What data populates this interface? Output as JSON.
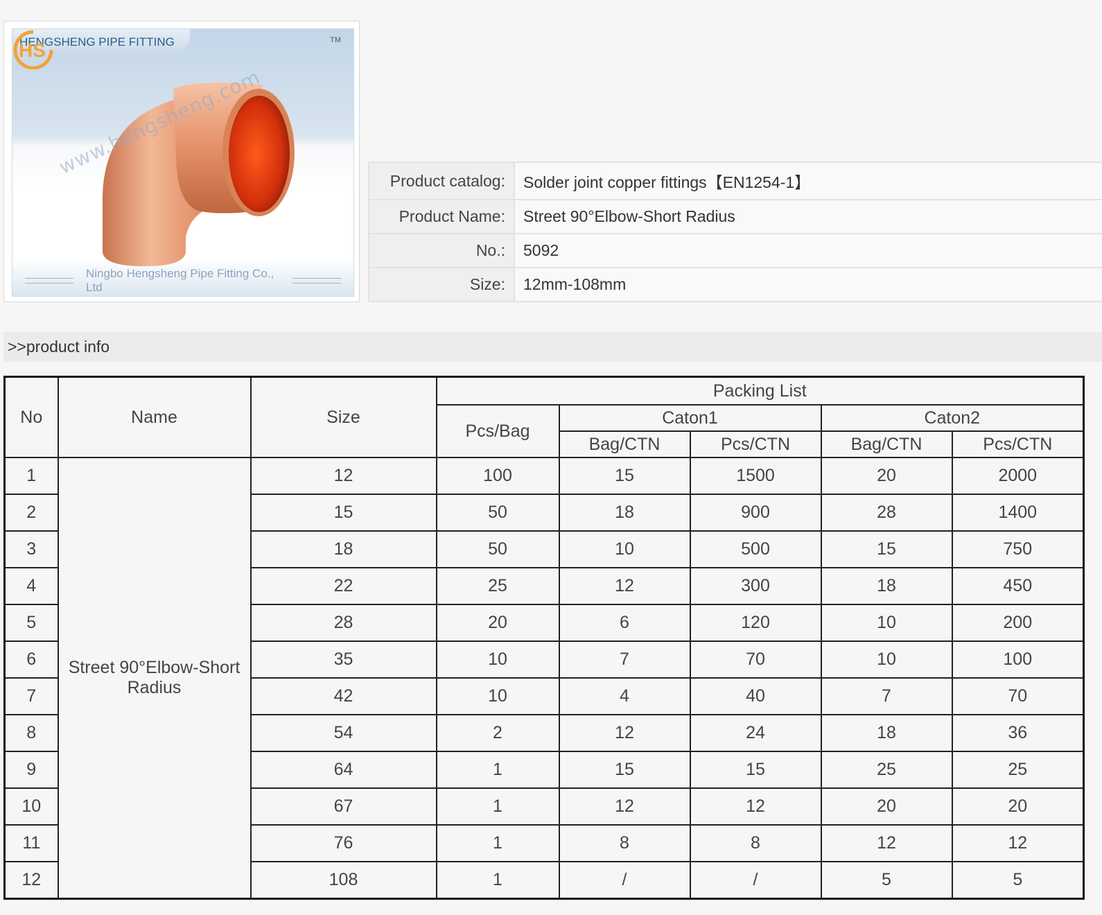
{
  "product_image": {
    "brand_tab": "HENGSHENG PIPE FITTING",
    "logo_text": "HS",
    "tm": "TM",
    "watermark": "www.hengsheng.com",
    "caption": "Ningbo Hengsheng Pipe Fitting Co., Ltd",
    "colors": {
      "copper": "#e0906a",
      "inner": "#d93a10",
      "brand_blue": "#2b5c8c",
      "logo_orange": "#f2a23a"
    }
  },
  "info": {
    "rows": [
      {
        "label": "Product catalog:",
        "value": "Solder joint copper fittings【EN1254-1】"
      },
      {
        "label": "Product Name:",
        "value": "Street 90°Elbow-Short Radius"
      },
      {
        "label": "No.:",
        "value": "5092"
      },
      {
        "label": "Size:",
        "value": "12mm-108mm"
      }
    ]
  },
  "section": {
    "title": ">>product info"
  },
  "packing": {
    "headers": {
      "no": "No",
      "name": "Name",
      "size": "Size",
      "packing_list": "Packing List",
      "pcs_bag": "Pcs/Bag",
      "caton1": "Caton1",
      "caton2": "Caton2",
      "bag_ctn": "Bag/CTN",
      "pcs_ctn": "Pcs/CTN"
    },
    "name": "Street 90°Elbow-Short Radius",
    "rows": [
      [
        "1",
        "12",
        "100",
        "15",
        "1500",
        "20",
        "2000"
      ],
      [
        "2",
        "15",
        "50",
        "18",
        "900",
        "28",
        "1400"
      ],
      [
        "3",
        "18",
        "50",
        "10",
        "500",
        "15",
        "750"
      ],
      [
        "4",
        "22",
        "25",
        "12",
        "300",
        "18",
        "450"
      ],
      [
        "5",
        "28",
        "20",
        "6",
        "120",
        "10",
        "200"
      ],
      [
        "6",
        "35",
        "10",
        "7",
        "70",
        "10",
        "100"
      ],
      [
        "7",
        "42",
        "10",
        "4",
        "40",
        "7",
        "70"
      ],
      [
        "8",
        "54",
        "2",
        "12",
        "24",
        "18",
        "36"
      ],
      [
        "9",
        "64",
        "1",
        "15",
        "15",
        "25",
        "25"
      ],
      [
        "10",
        "67",
        "1",
        "12",
        "12",
        "20",
        "20"
      ],
      [
        "11",
        "76",
        "1",
        "8",
        "8",
        "12",
        "12"
      ],
      [
        "12",
        "108",
        "1",
        "/",
        "/",
        "5",
        "5"
      ]
    ]
  }
}
